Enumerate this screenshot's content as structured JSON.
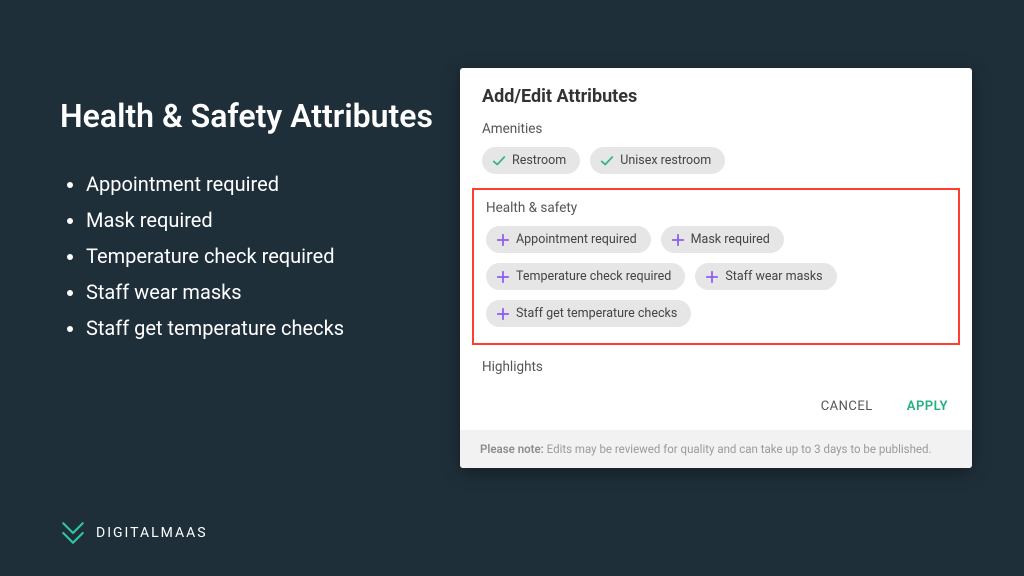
{
  "slide": {
    "title": "Health & Safety Attributes",
    "bullets": [
      "Appointment required",
      "Mask required",
      "Temperature check required",
      "Staff wear masks",
      "Staff get temperature checks"
    ]
  },
  "logo": {
    "text": "DIGITALMAAS"
  },
  "modal": {
    "title": "Add/Edit Attributes",
    "sections": {
      "amenities": {
        "label": "Amenities",
        "chips": [
          {
            "label": "Restroom",
            "state": "check"
          },
          {
            "label": "Unisex restroom",
            "state": "check"
          }
        ]
      },
      "health_safety": {
        "label": "Health & safety",
        "chips": [
          {
            "label": "Appointment required",
            "state": "plus"
          },
          {
            "label": "Mask required",
            "state": "plus"
          },
          {
            "label": "Temperature check required",
            "state": "plus"
          },
          {
            "label": "Staff wear masks",
            "state": "plus"
          },
          {
            "label": "Staff get temperature checks",
            "state": "plus"
          }
        ]
      },
      "highlights": {
        "label": "Highlights"
      }
    },
    "actions": {
      "cancel": "CANCEL",
      "apply": "APPLY"
    },
    "footer": {
      "bold": "Please note:",
      "rest": " Edits may be reviewed for quality and can take up to 3 days to be published."
    }
  }
}
